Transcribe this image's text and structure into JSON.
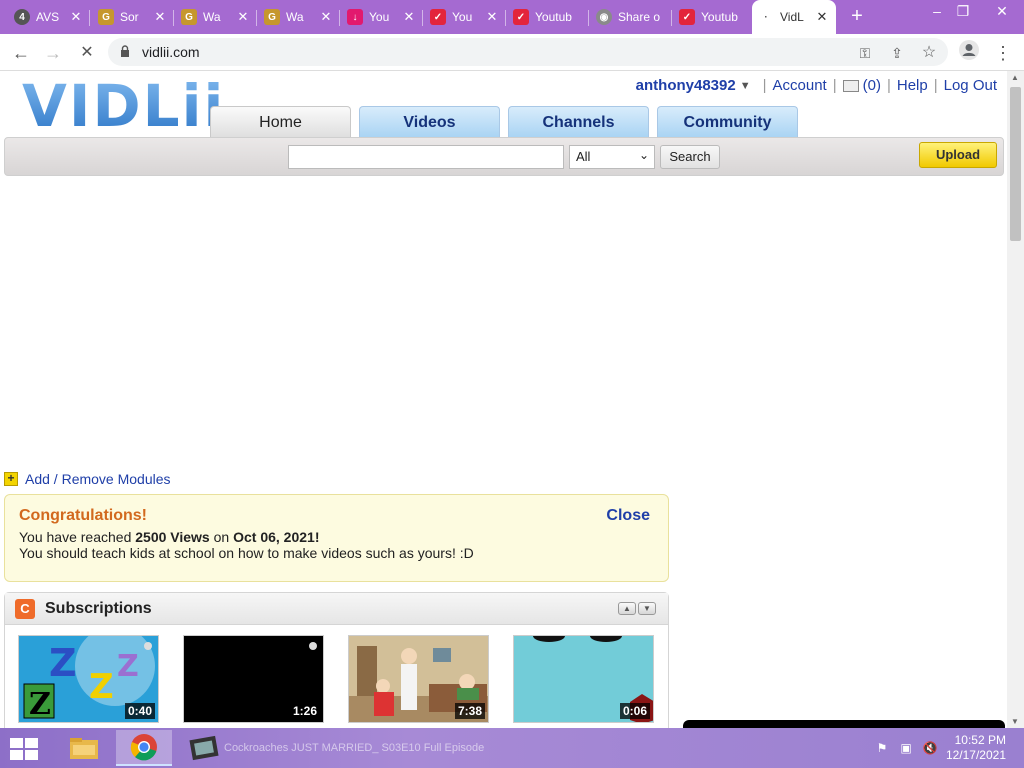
{
  "browser": {
    "tabs": [
      {
        "label": "AVS",
        "favicon": "4",
        "color": "#555555"
      },
      {
        "label": "Sor",
        "favicon": "G",
        "color": "#c6972e"
      },
      {
        "label": "Wa",
        "favicon": "G",
        "color": "#c6972e"
      },
      {
        "label": "Wa",
        "favicon": "G",
        "color": "#c6972e"
      },
      {
        "label": "You",
        "favicon": "↓",
        "color": "#e2196e"
      },
      {
        "label": "You",
        "favicon": "✓",
        "color": "#e3243b"
      },
      {
        "label": "Youtub",
        "favicon": "✓",
        "color": "#e3243b"
      },
      {
        "label": "Share o",
        "favicon": "◉",
        "color": "#8a8a8a"
      },
      {
        "label": "Youtub",
        "favicon": "✓",
        "color": "#e3243b"
      },
      {
        "label": "VidL",
        "favicon": "·",
        "color": "#ffffff",
        "active": true
      }
    ],
    "new_tab": "+",
    "url": "vidlii.com",
    "window_controls": {
      "minimize": "–",
      "maximize": "❐",
      "close": "✕"
    }
  },
  "header": {
    "logo_text": "VIDLii",
    "username": "anthony48392",
    "account_label": "Account",
    "inbox_count": "(0)",
    "help_label": "Help",
    "logout_label": "Log Out"
  },
  "nav": {
    "tabs": [
      {
        "label": "Home",
        "active": true
      },
      {
        "label": "Videos"
      },
      {
        "label": "Channels"
      },
      {
        "label": "Community"
      }
    ]
  },
  "search": {
    "input_value": "",
    "category_selected": "All",
    "button_label": "Search",
    "upload_label": "Upload"
  },
  "modules": {
    "label": "Add / Remove Modules"
  },
  "congrats": {
    "title": "Congratulations!",
    "close_label": "Close",
    "line1_prefix": "You have reached ",
    "line1_views": "2500 Views",
    "line1_mid": " on ",
    "line1_date": "Oct 06, 2021",
    "line1_suffix": "!",
    "line2": "You should teach kids at school on how to make videos such as yours! :D"
  },
  "subscriptions": {
    "title": "Subscriptions",
    "videos": [
      {
        "duration": "0:40"
      },
      {
        "duration": "1:26"
      },
      {
        "duration": "7:38"
      },
      {
        "duration": "0:06"
      }
    ]
  },
  "taskbar": {
    "media_title": "Cockroaches JUST MARRIED_ S03E10 Full Episode",
    "time": "10:52 PM",
    "date": "12/17/2021"
  }
}
